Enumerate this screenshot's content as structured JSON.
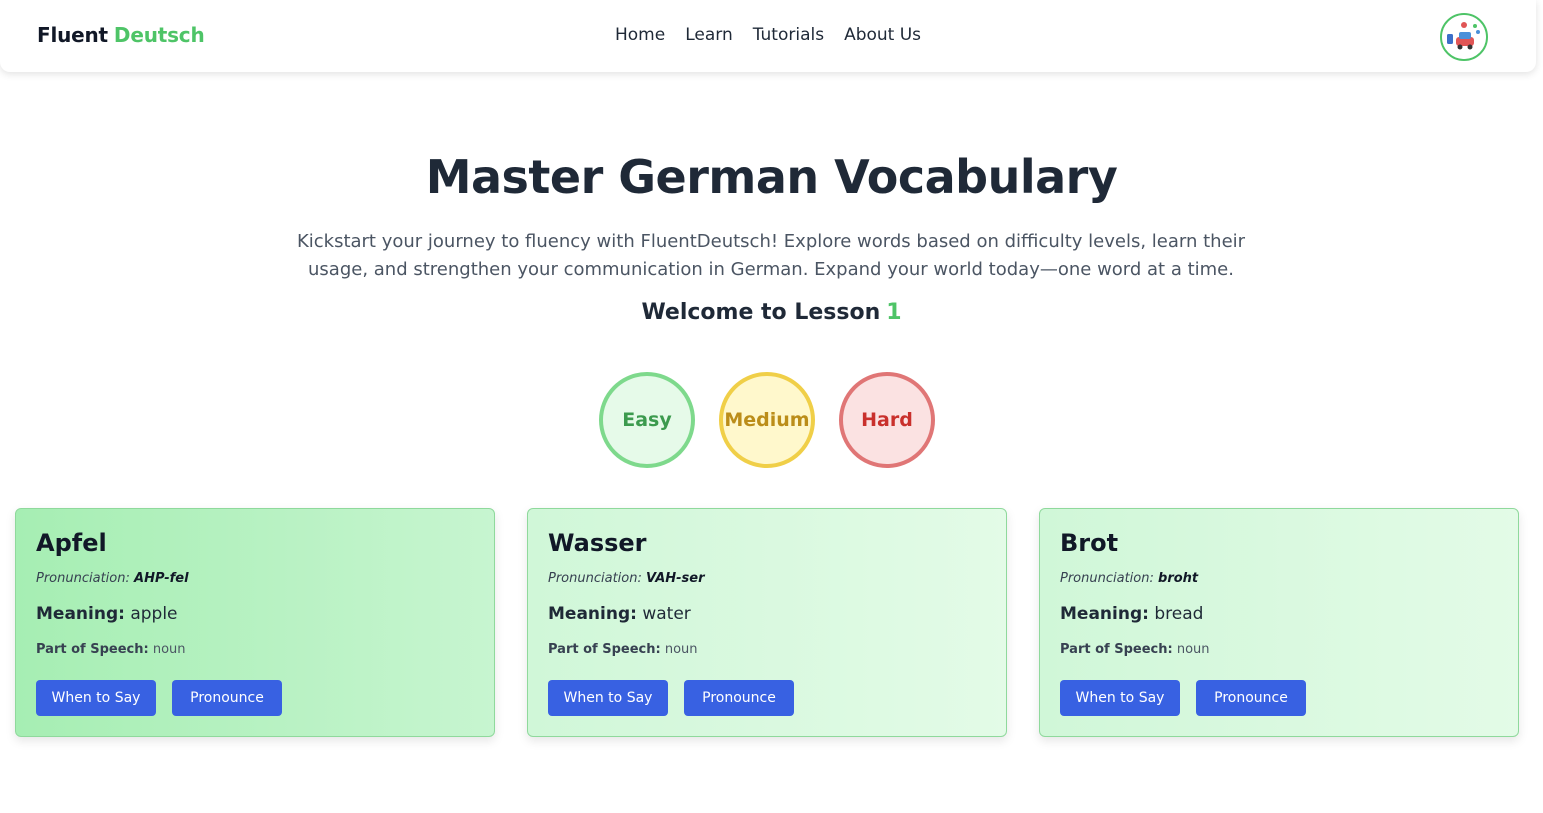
{
  "navbar": {
    "logo_part1": "Fluent",
    "logo_part2": "Deutsch",
    "links": [
      "Home",
      "Learn",
      "Tutorials",
      "About Us"
    ],
    "avatar_icon": "user-avatar-icon"
  },
  "hero": {
    "title": "Master German Vocabulary",
    "description": "Kickstart your journey to fluency with FluentDeutsch! Explore words based on difficulty levels, learn their usage, and strengthen your communication in German. Expand your world today—one word at a time.",
    "lesson_label": "Welcome to Lesson",
    "lesson_number": "1"
  },
  "difficulty": {
    "easy": "Easy",
    "medium": "Medium",
    "hard": "Hard"
  },
  "colors": {
    "brand_green": "#4ec467",
    "button_blue": "#3861e2",
    "easy": "#7ed98c",
    "medium": "#f0cf48",
    "hard": "#e07676"
  },
  "labels": {
    "pronunciation": "Pronunciation:",
    "meaning": "Meaning:",
    "part_of_speech": "Part of Speech:",
    "when_to_say": "When to Say",
    "pronounce": "Pronounce"
  },
  "cards": [
    {
      "word": "Apfel",
      "pronunciation": "AHP-fel",
      "meaning": "apple",
      "part_of_speech": "noun"
    },
    {
      "word": "Wasser",
      "pronunciation": "VAH-ser",
      "meaning": "water",
      "part_of_speech": "noun"
    },
    {
      "word": "Brot",
      "pronunciation": "broht",
      "meaning": "bread",
      "part_of_speech": "noun"
    }
  ]
}
